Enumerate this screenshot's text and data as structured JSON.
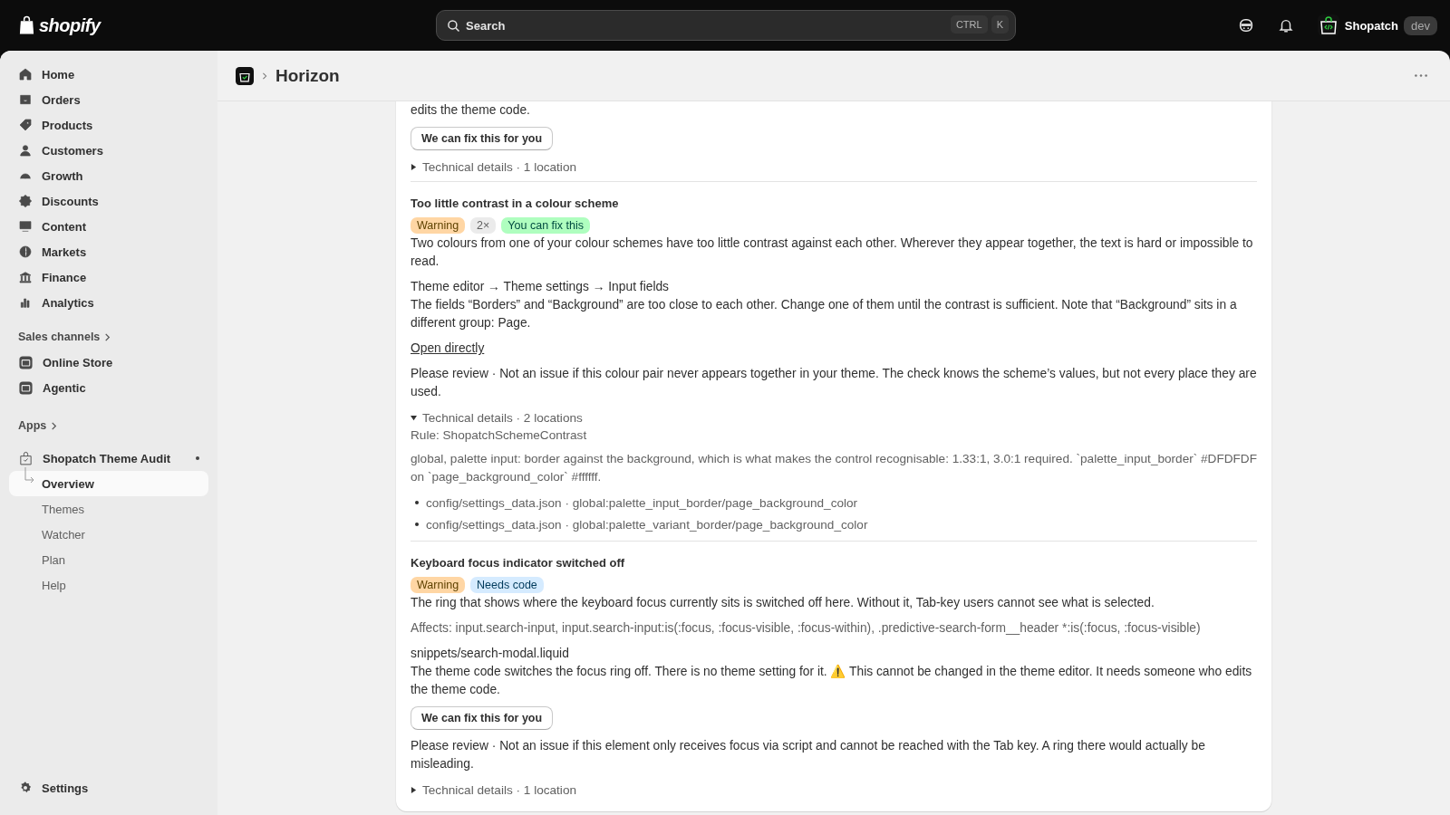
{
  "topbar": {
    "logo": "shopify",
    "search": {
      "placeholder": "Search",
      "keys": [
        "CTRL",
        "K"
      ]
    },
    "store": {
      "name": "Shopatch",
      "badge": "dev"
    }
  },
  "sidebar": {
    "items": [
      {
        "label": "Home",
        "selected": false
      },
      {
        "label": "Orders",
        "selected": false
      },
      {
        "label": "Products",
        "selected": false
      },
      {
        "label": "Customers",
        "selected": false
      },
      {
        "label": "Growth",
        "selected": false
      },
      {
        "label": "Discounts",
        "selected": false
      },
      {
        "label": "Content",
        "selected": false
      },
      {
        "label": "Markets",
        "selected": false
      },
      {
        "label": "Finance",
        "selected": false
      },
      {
        "label": "Analytics",
        "selected": false
      }
    ],
    "sales_channels": {
      "heading": "Sales channels",
      "items": [
        {
          "label": "Online Store",
          "selected": false
        },
        {
          "label": "Agentic",
          "selected": false
        }
      ]
    },
    "apps": {
      "heading": "Apps",
      "app": {
        "label": "Shopatch Theme Audit",
        "expanded": true,
        "children": [
          {
            "label": "Overview",
            "selected": true
          },
          {
            "label": "Themes",
            "selected": false
          },
          {
            "label": "Watcher",
            "selected": false
          },
          {
            "label": "Plan",
            "selected": false
          },
          {
            "label": "Help",
            "selected": false
          }
        ]
      }
    },
    "settings": "Settings"
  },
  "page": {
    "title": "Horizon"
  },
  "issues": [
    {
      "blocks": [
        {
          "kind": "text",
          "text": "edits the theme code."
        },
        {
          "kind": "button",
          "text": "We can fix this for you"
        }
      ],
      "details": {
        "label": "Technical details · 1 location",
        "expanded": false
      }
    },
    {
      "title": "Too little contrast in a colour scheme",
      "badges": [
        {
          "kind": "warning",
          "text": "Warning"
        },
        {
          "kind": "count",
          "text": "2×"
        },
        {
          "kind": "fixable",
          "text": "You can fix this"
        }
      ],
      "blocks": [
        {
          "kind": "text",
          "text": "Two colours from one of your colour schemes have too little contrast against each other. Wherever they appear together, the text is hard or impossible to read."
        },
        {
          "kind": "path",
          "text": "Theme editor → Theme settings → Input fields"
        },
        {
          "kind": "text",
          "text": "The fields “Borders” and “Background” are too close to each other. Change one of them until the contrast is sufficient. Note that “Background” sits in a different group: Page."
        },
        {
          "kind": "link",
          "text": "Open directly"
        },
        {
          "kind": "note",
          "text": "Please review · Not an issue if this colour pair never appears together in your theme. The check knows the scheme’s values, but not every place they are used."
        }
      ],
      "details": {
        "label": "Technical details · 2 locations",
        "expanded": true,
        "rule": "Rule: ShopatchSchemeContrast",
        "description": "global, palette input: border against the background, which is what makes the control recognisable: 1.33:1, 3.0:1 required. `palette_input_border` #DFDFDF on `page_background_color` #ffffff.",
        "locations": [
          "config/settings_data.json · global:palette_input_border/page_background_color",
          "config/settings_data.json · global:palette_variant_border/page_background_color"
        ]
      }
    },
    {
      "title": "Keyboard focus indicator switched off",
      "badges": [
        {
          "kind": "warning",
          "text": "Warning"
        },
        {
          "kind": "code",
          "text": "Needs code"
        }
      ],
      "blocks": [
        {
          "kind": "text",
          "text": "The ring that shows where the keyboard focus currently sits is switched off here. Without it, Tab-key users cannot see what is selected."
        },
        {
          "kind": "affects",
          "text": "Affects: input.search-input, input.search-input:is(:focus, :focus-visible, :focus-within), .predictive-search-form__header *:is(:focus, :focus-visible)"
        },
        {
          "kind": "path",
          "text": "snippets/search-modal.liquid"
        },
        {
          "kind": "text",
          "text": "The theme code switches the focus ring off. There is no theme setting for it. ⚠️ This cannot be changed in the theme editor. It needs someone who edits the theme code."
        },
        {
          "kind": "button",
          "text": "We can fix this for you"
        },
        {
          "kind": "note",
          "text": "Please review · Not an issue if this element only receives focus via script and cannot be reached with the Tab key. A ring there would actually be misleading."
        }
      ],
      "details": {
        "label": "Technical details · 1 location",
        "expanded": false
      }
    }
  ]
}
